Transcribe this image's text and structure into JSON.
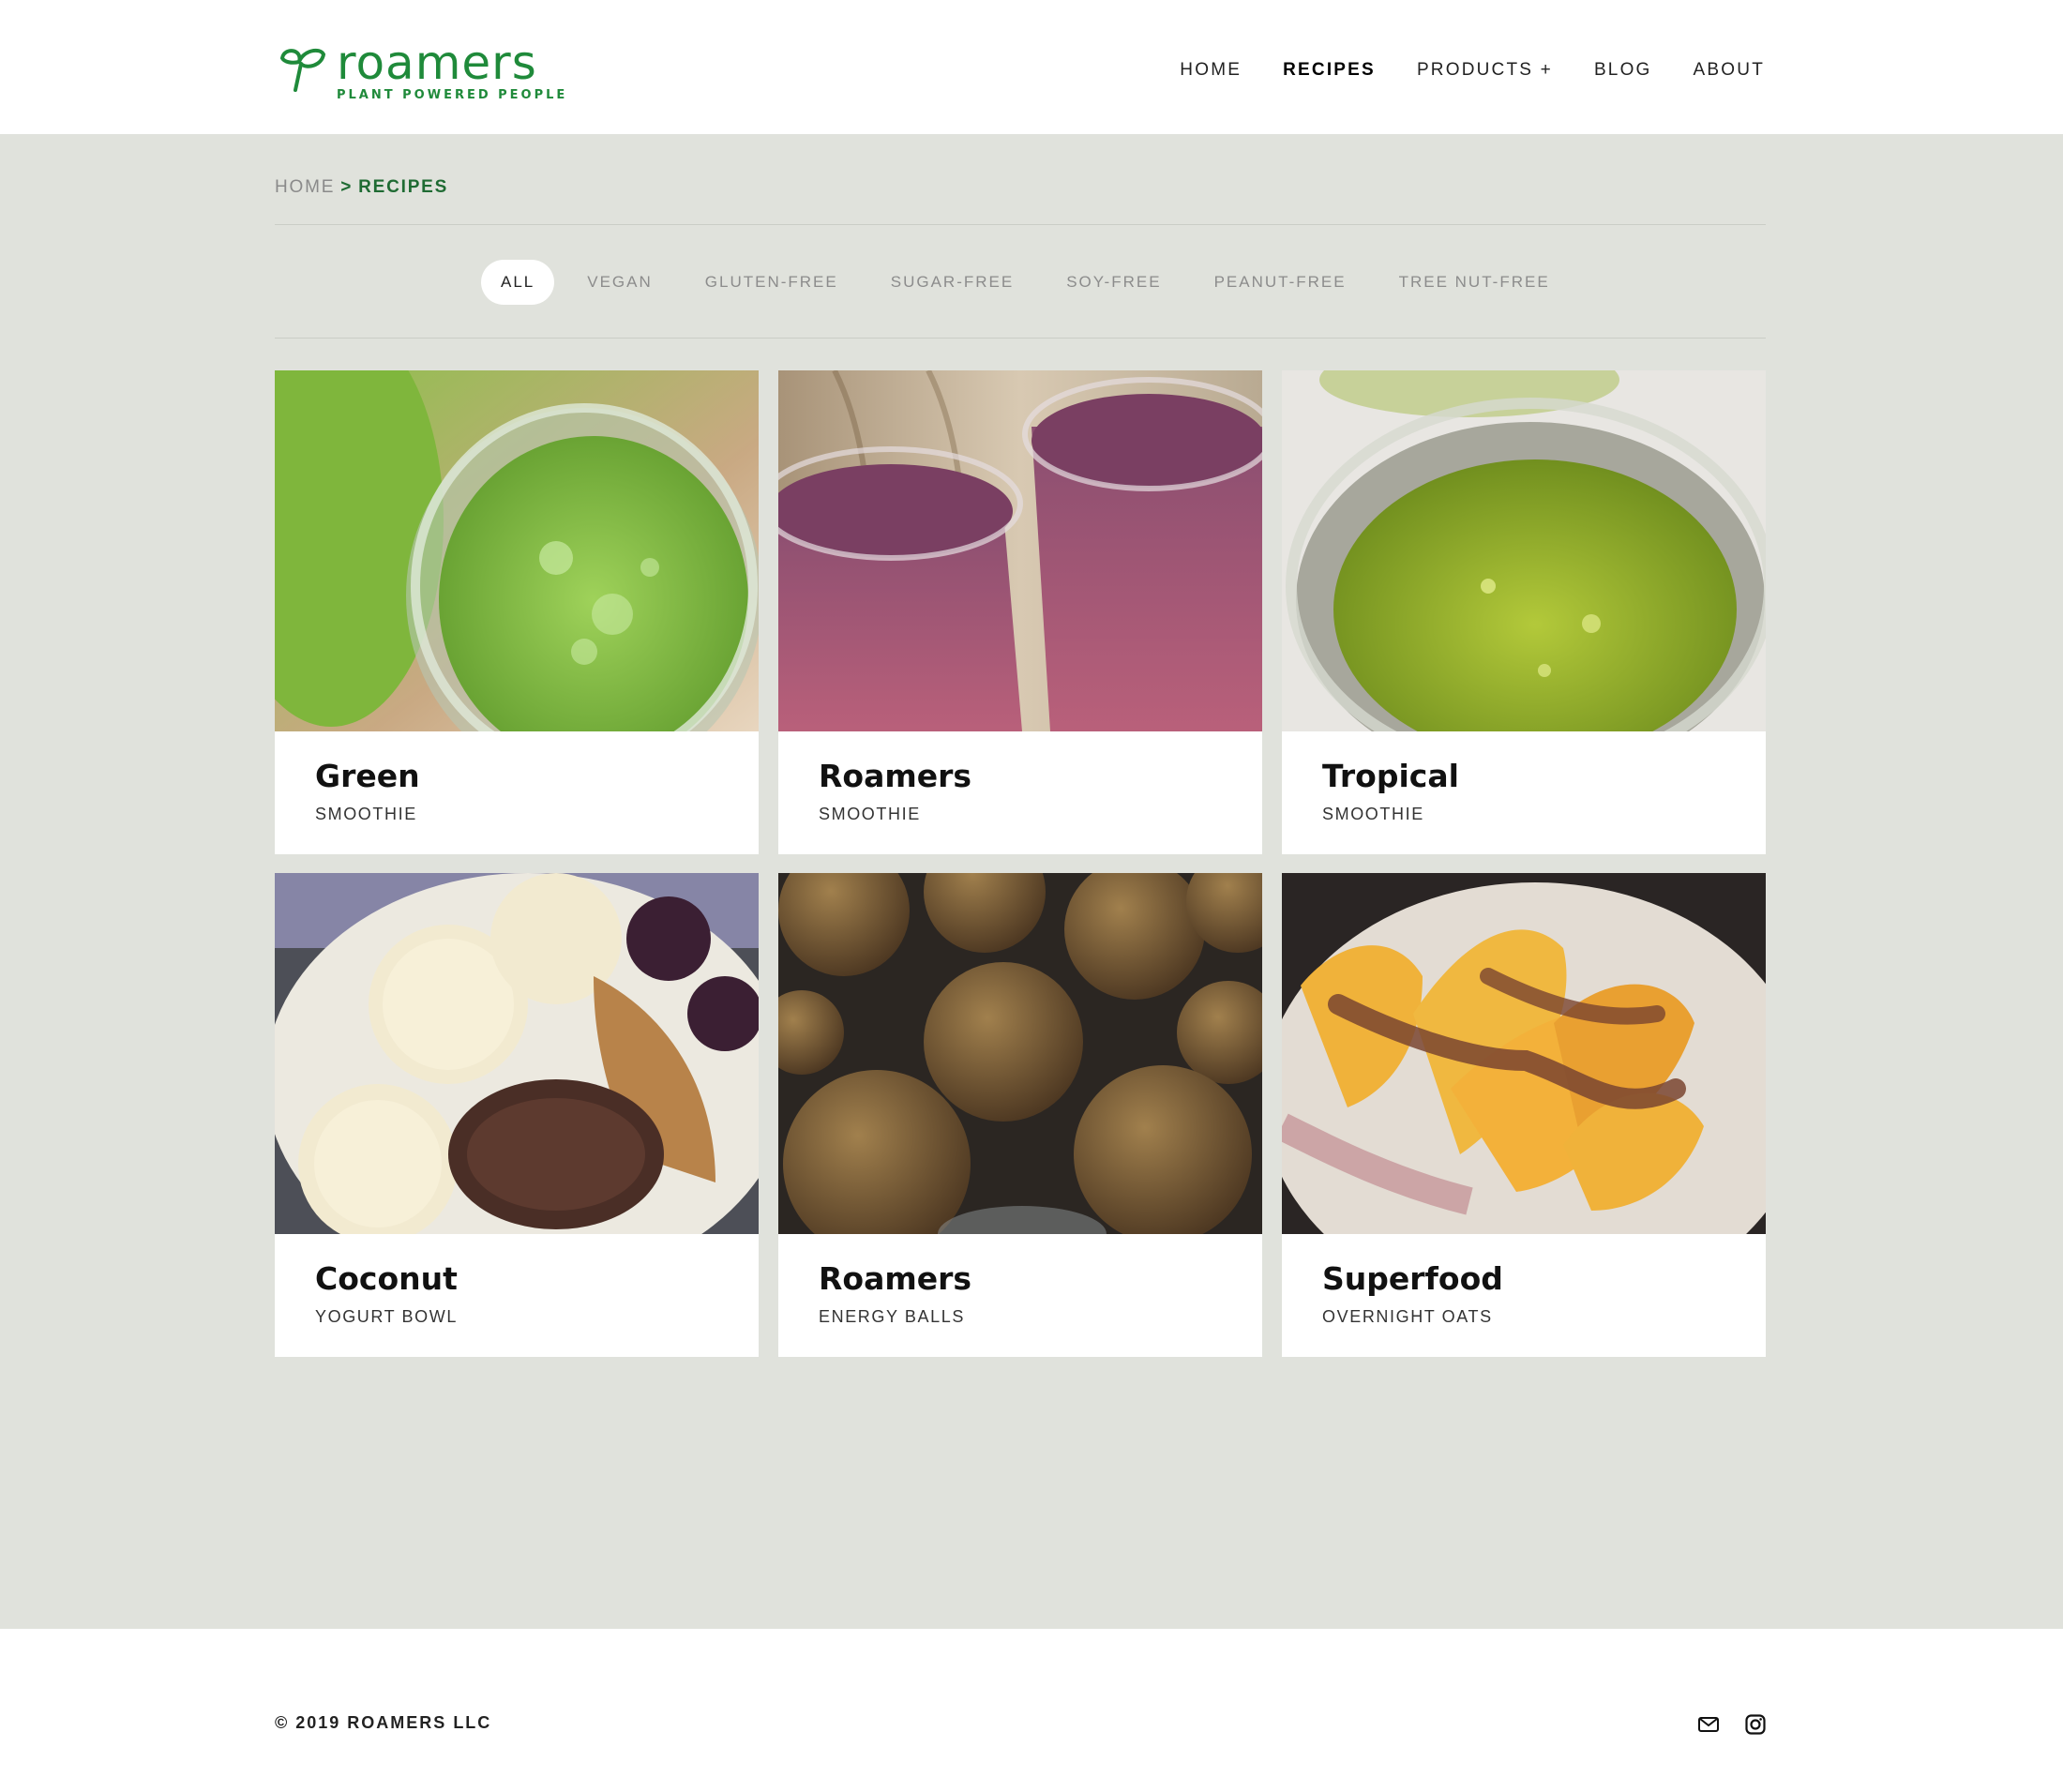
{
  "brand": {
    "name": "roamers",
    "tagline": "PLANT POWERED PEOPLE",
    "color": "#1f8a3a"
  },
  "nav": {
    "items": [
      {
        "label": "HOME"
      },
      {
        "label": "RECIPES"
      },
      {
        "label": "PRODUCTS +"
      },
      {
        "label": "BLOG"
      },
      {
        "label": "ABOUT"
      }
    ],
    "active": "RECIPES"
  },
  "breadcrumb": {
    "home": "HOME",
    "separator": ">",
    "current": "RECIPES"
  },
  "filters": {
    "items": [
      "ALL",
      "VEGAN",
      "GLUTEN-FREE",
      "SUGAR-FREE",
      "SOY-FREE",
      "PEANUT-FREE",
      "TREE NUT-FREE"
    ],
    "active": "ALL"
  },
  "recipes": [
    {
      "title": "Green",
      "subtitle": "SMOOTHIE",
      "image": "green-smoothie-jar"
    },
    {
      "title": "Roamers",
      "subtitle": "SMOOTHIE",
      "image": "berry-smoothie-glasses"
    },
    {
      "title": "Tropical",
      "subtitle": "SMOOTHIE",
      "image": "tropical-smoothie-jar"
    },
    {
      "title": "Coconut",
      "subtitle": "YOGURT BOWL",
      "image": "yogurt-bowl-banana"
    },
    {
      "title": "Roamers",
      "subtitle": "ENERGY BALLS",
      "image": "energy-balls"
    },
    {
      "title": "Superfood",
      "subtitle": "OVERNIGHT OATS",
      "image": "oats-peaches"
    }
  ],
  "footer": {
    "copyright": "© 2019 ROAMERS LLC",
    "icons": [
      "mail-icon",
      "instagram-icon"
    ]
  },
  "colors": {
    "page_bg": "#e0e2dc",
    "accent": "#1f6b33"
  }
}
